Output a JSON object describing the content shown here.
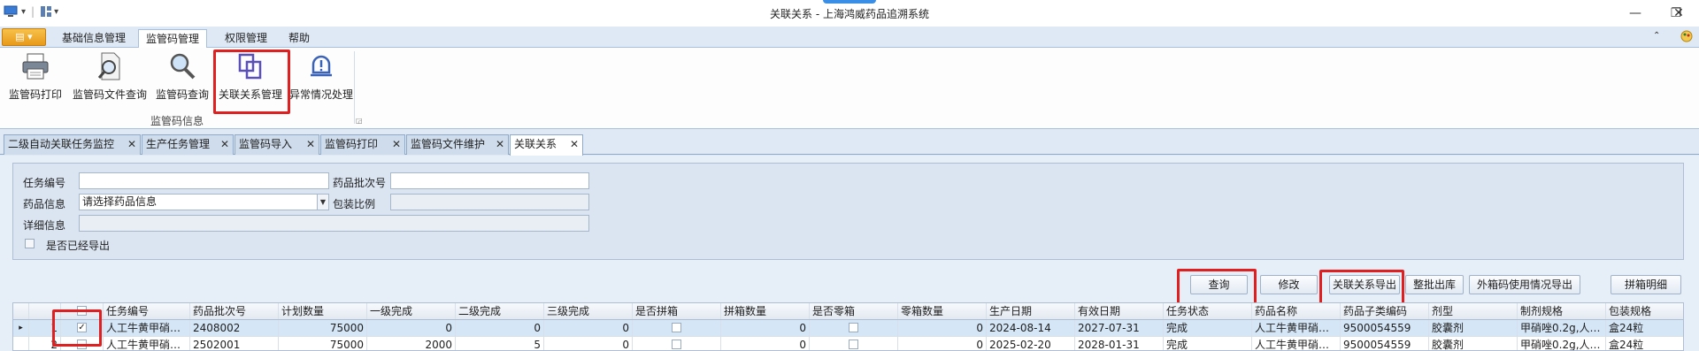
{
  "window": {
    "title": "关联关系 - 上海鸿威药品追溯系统",
    "minimize_glyph": "—",
    "restore_glyph": "❐",
    "close_glyph": "✕"
  },
  "menubar": {
    "tabs": [
      "基础信息管理",
      "监管码管理",
      "权限管理",
      "帮助"
    ],
    "active_tab": "监管码管理"
  },
  "ribbon": {
    "buttons": [
      {
        "label": "监管码打印",
        "icon": "printer-icon"
      },
      {
        "label": "监管码文件查询",
        "icon": "document-search-icon"
      },
      {
        "label": "监管码查询",
        "icon": "magnifier-icon"
      },
      {
        "label": "关联关系管理",
        "icon": "link-squares-icon"
      },
      {
        "label": "异常情况处理",
        "icon": "alert-bell-icon"
      }
    ],
    "group_label": "监管码信息"
  },
  "doc_tabs": [
    "二级自动关联任务监控",
    "生产任务管理",
    "监管码导入",
    "监管码打印",
    "监管码文件维护",
    "关联关系"
  ],
  "active_doc_tab": "关联关系",
  "filter": {
    "task_no_label": "任务编号",
    "task_no_value": "",
    "batch_no_label": "药品批次号",
    "batch_no_value": "",
    "drug_info_label": "药品信息",
    "drug_info_value": "请选择药品信息",
    "pack_ratio_label": "包装比例",
    "pack_ratio_value": "",
    "detail_label": "详细信息",
    "detail_value": "",
    "exported_label": "是否已经导出"
  },
  "actions": [
    "查询",
    "修改",
    "关联关系导出",
    "整批出库",
    "外箱码使用情况导出",
    "拼箱明细"
  ],
  "grid": {
    "columns": [
      "",
      "",
      "任务编号",
      "药品批次号",
      "计划数量",
      "一级完成",
      "二级完成",
      "三级完成",
      "是否拼箱",
      "拼箱数量",
      "是否零箱",
      "零箱数量",
      "生产日期",
      "有效日期",
      "任务状态",
      "药品名称",
      "药品子类编码",
      "剂型",
      "制剂规格",
      "包装规格"
    ],
    "rows": [
      {
        "indicator": "▸",
        "no": "1",
        "checked": true,
        "task_no": "人工牛黄甲硝…",
        "batch": "2408002",
        "plan": "75000",
        "l1": "0",
        "l2": "0",
        "l3": "0",
        "pin": false,
        "pin_qty": "0",
        "zero": false,
        "zero_qty": "0",
        "prod_date": "2024-08-14",
        "exp_date": "2027-07-31",
        "status": "完成",
        "drug_name": "人工牛黄甲硝…",
        "sub_code": "9500054559",
        "form": "胶囊剂",
        "spec": "甲硝唑0.2g,人…",
        "pack": "盒24粒"
      },
      {
        "indicator": "",
        "no": "2",
        "checked": false,
        "task_no": "人工牛黄甲硝…",
        "batch": "2502001",
        "plan": "75000",
        "l1": "2000",
        "l2": "5",
        "l3": "0",
        "pin": false,
        "pin_qty": "0",
        "zero": false,
        "zero_qty": "0",
        "prod_date": "2025-02-20",
        "exp_date": "2028-01-31",
        "status": "完成",
        "drug_name": "人工牛黄甲硝…",
        "sub_code": "9500054559",
        "form": "胶囊剂",
        "spec": "甲硝唑0.2g,人…",
        "pack": "盒24粒"
      }
    ]
  },
  "colors": {
    "highlight": "#e02020",
    "ribbon_bg": "#fdfdfe",
    "selected_row": "#d5e6f7"
  }
}
